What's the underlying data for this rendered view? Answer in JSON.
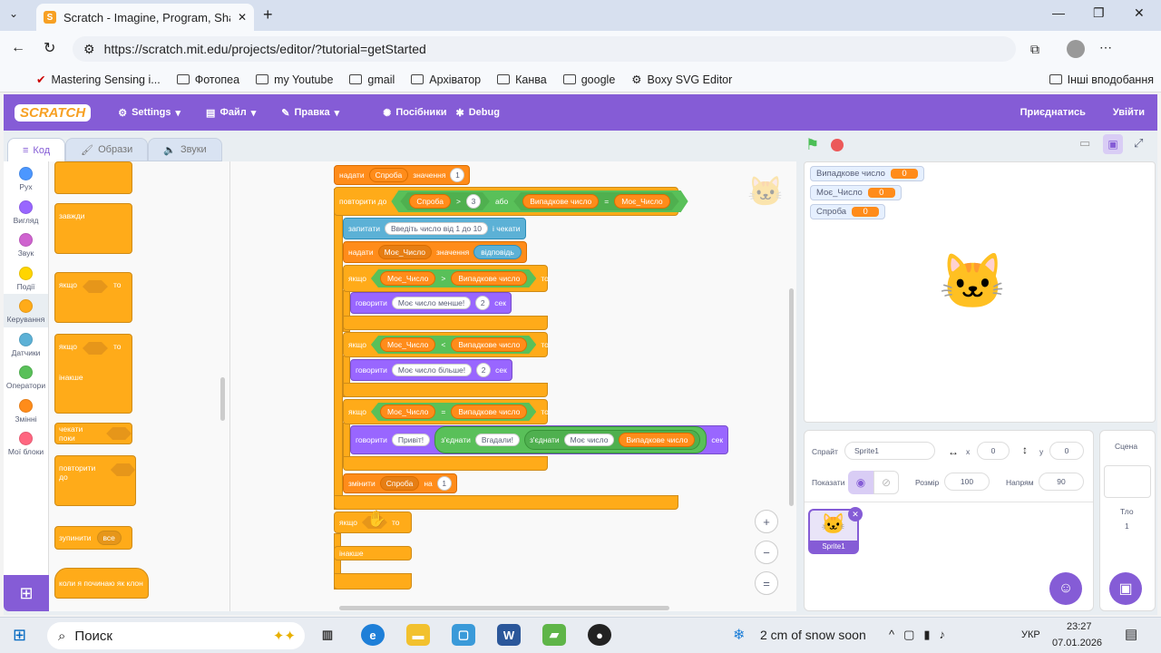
{
  "browser": {
    "tab_title": "Scratch - Imagine, Program, Share",
    "url": "https://scratch.mit.edu/projects/editor/?tutorial=getStarted",
    "bookmarks": [
      "Mastering Sensing i...",
      "Фотопеа",
      "my Youtube",
      "gmail",
      "Архіватор",
      "Канва",
      "google",
      "Boxy SVG Editor"
    ],
    "other_bookmarks": "Інші вподобання"
  },
  "menu": {
    "logo": "SCRATCH",
    "settings": "Settings",
    "file": "Файл",
    "edit": "Правка",
    "tutorials": "Посібники",
    "debug": "Debug",
    "join": "Приєднатись",
    "signin": "Увійти"
  },
  "tabs": {
    "code": "Код",
    "costumes": "Образи",
    "sounds": "Звуки"
  },
  "categories": [
    {
      "label": "Рух",
      "color": "#4c97ff"
    },
    {
      "label": "Вигляд",
      "color": "#9966ff"
    },
    {
      "label": "Звук",
      "color": "#cf63cf"
    },
    {
      "label": "Події",
      "color": "#ffd500"
    },
    {
      "label": "Керування",
      "color": "#ffab19"
    },
    {
      "label": "Датчики",
      "color": "#5cb1d6"
    },
    {
      "label": "Оператори",
      "color": "#59c059"
    },
    {
      "label": "Змінні",
      "color": "#ff8c1a"
    },
    {
      "label": "Мої блоки",
      "color": "#ff6680"
    }
  ],
  "palette": {
    "forever": "завжди",
    "if": "якщо",
    "then": "то",
    "else": "інакше",
    "wait_until": "чекати поки",
    "repeat_until": "повторити до",
    "stop": "зупинити",
    "stop_option": "все",
    "when_clone": "коли я починаю як клон"
  },
  "script": {
    "set": "надати",
    "to_value": "значення",
    "var_try": "Спроба",
    "var_my": "Моє_Число",
    "var_rand": "Випадкове число",
    "one": "1",
    "repeat_until": "повторити до",
    "gt": ">",
    "lt": "<",
    "eq": "=",
    "three": "3",
    "or": "або",
    "ask": "запитати",
    "ask_text": "Введіть число від 1 до 10",
    "and_wait": "і чекати",
    "answer": "відповідь",
    "if": "якщо",
    "then": "то",
    "say": "говорити",
    "say_less": "Моє число менше!",
    "say_more": "Моє число більше!",
    "two": "2",
    "sec": "сек",
    "hello": "Привіт!",
    "join": "з'єднати",
    "guessed": "Вгадали!",
    "my_number": "Моє число",
    "change": "змінити",
    "by": "на",
    "else": "інакше"
  },
  "monitors": [
    {
      "name": "Випадкове число",
      "value": "0"
    },
    {
      "name": "Моє_Число",
      "value": "0"
    },
    {
      "name": "Спроба",
      "value": "0"
    }
  ],
  "sprite_info": {
    "sprite_label": "Спрайт",
    "sprite_name": "Sprite1",
    "x_label": "x",
    "x": "0",
    "y_label": "y",
    "y": "0",
    "show_label": "Показати",
    "size_label": "Розмір",
    "size": "100",
    "direction_label": "Напрям",
    "direction": "90",
    "thumb_name": "Sprite1"
  },
  "backdrop": {
    "stage_label": "Сцена",
    "backdrops_label": "Тло",
    "count": "1"
  },
  "taskbar": {
    "search": "Поиск",
    "weather": "2 cm of snow soon",
    "lang": "УКР",
    "time": "23:27",
    "date": "07.01.2026"
  }
}
